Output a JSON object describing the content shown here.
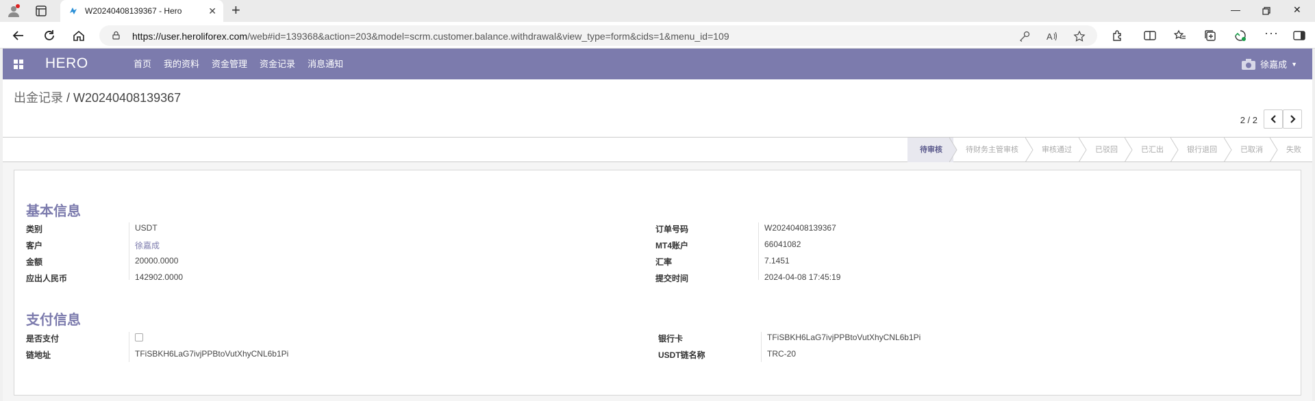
{
  "browser": {
    "tab_title": "W20240408139367 - Hero",
    "url_host": "https://user.heroliforex.com",
    "url_rest": "/web#id=139368&action=203&model=scrm.customer.balance.withdrawal&view_type=form&cids=1&menu_id=109"
  },
  "navbar": {
    "brand": "HERO",
    "menu": [
      "首页",
      "我的资料",
      "资金管理",
      "资金记录",
      "消息通知"
    ],
    "user": "徐嘉成"
  },
  "breadcrumb": {
    "parent": "出金记录",
    "separator": " / ",
    "current": "W20240408139367"
  },
  "pager": {
    "text": "2 / 2"
  },
  "stages": [
    "待审核",
    "待财务主管审核",
    "审核通过",
    "已驳回",
    "已汇出",
    "银行退回",
    "已取消",
    "失败"
  ],
  "active_stage": "待审核",
  "sections": {
    "basic": {
      "title": "基本信息",
      "left": [
        {
          "label": "类别",
          "value": "USDT"
        },
        {
          "label": "客户",
          "value": "徐嘉成"
        },
        {
          "label": "金额",
          "value": "20000.0000"
        },
        {
          "label": "应出人民币",
          "value": "142902.0000"
        }
      ],
      "right": [
        {
          "label": "订单号码",
          "value": "W20240408139367"
        },
        {
          "label": "MT4账户",
          "value": "66041082"
        },
        {
          "label": "汇率",
          "value": "7.1451"
        },
        {
          "label": "提交时间",
          "value": "2024-04-08 17:45:19"
        }
      ]
    },
    "payment": {
      "title": "支付信息",
      "left": [
        {
          "label": "是否支付",
          "value": ""
        },
        {
          "label": "链地址",
          "value": "TFiSBKH6LaG7ivjPPBtoVutXhyCNL6b1Pi"
        }
      ],
      "right": [
        {
          "label": "银行卡",
          "value": "TFiSBKH6LaG7ivjPPBtoVutXhyCNL6b1Pi"
        },
        {
          "label": "USDT链名称",
          "value": "TRC-20"
        }
      ],
      "is_paid": false
    }
  },
  "colors": {
    "brand": "#7c7bad",
    "active_stage_bg": "#e8e8ef"
  }
}
